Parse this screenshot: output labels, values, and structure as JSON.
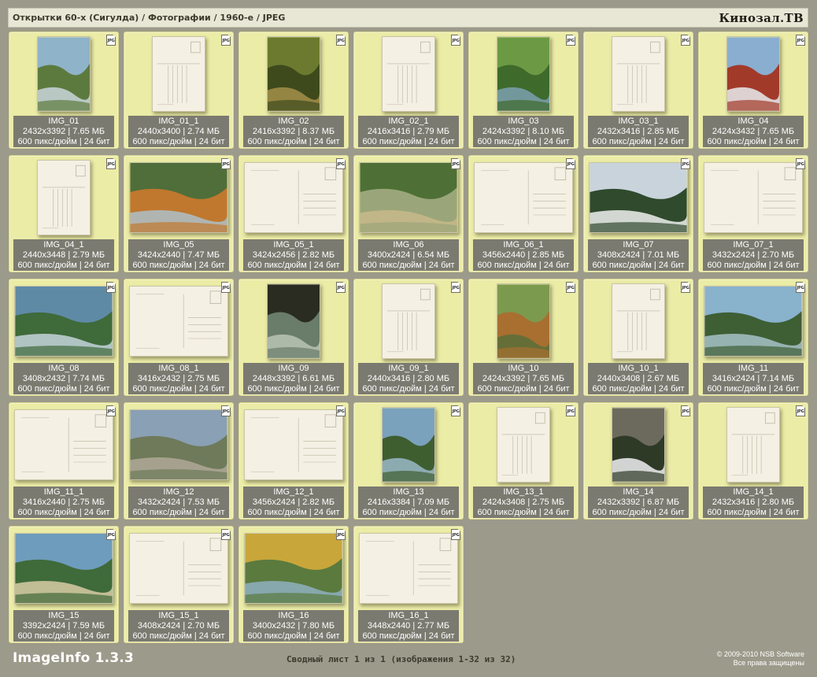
{
  "header": {
    "breadcrumb": "Открытки 60-х (Сигулда) / Фотографии / 1960-е / JPEG",
    "site": "Кинозал.ТВ"
  },
  "badge_label": "JPG",
  "tiles": [
    {
      "name": "IMG_01",
      "dims": "2432x3392 | 7.65 МБ",
      "meta": "600 пикс/дюйм | 24 бит",
      "orient": "portrait",
      "kind": "photo",
      "icon": "landscape-river-photo",
      "colors": [
        "#8fb3c8",
        "#5d7a3e",
        "#c9d6da"
      ]
    },
    {
      "name": "IMG_01_1",
      "dims": "2440x3400 | 2.74 МБ",
      "meta": "600 пикс/дюйм | 24 бит",
      "orient": "portrait",
      "kind": "back"
    },
    {
      "name": "IMG_02",
      "dims": "2416x3392 | 8.37 МБ",
      "meta": "600 пикс/дюйм | 24 бит",
      "orient": "portrait",
      "kind": "photo",
      "icon": "forest-cliff-photo",
      "colors": [
        "#6b7a2e",
        "#3e4a1c",
        "#a58f4a"
      ]
    },
    {
      "name": "IMG_02_1",
      "dims": "2416x3416 | 2.79 МБ",
      "meta": "600 пикс/дюйм | 24 бит",
      "orient": "portrait",
      "kind": "back"
    },
    {
      "name": "IMG_03",
      "dims": "2424x3392 | 8.10 МБ",
      "meta": "600 пикс/дюйм | 24 бит",
      "orient": "portrait",
      "kind": "photo",
      "icon": "river-valley-photo",
      "colors": [
        "#6c9a44",
        "#3e6a2c",
        "#7ca0b0"
      ]
    },
    {
      "name": "IMG_03_1",
      "dims": "2432x3416 | 2.85 МБ",
      "meta": "600 пикс/дюйм | 24 бит",
      "orient": "portrait",
      "kind": "back"
    },
    {
      "name": "IMG_04",
      "dims": "2424x3432 | 7.65 МБ",
      "meta": "600 пикс/дюйм | 24 бит",
      "orient": "portrait",
      "kind": "photo",
      "icon": "castle-tower-winter-photo",
      "colors": [
        "#8aaed0",
        "#a23a2a",
        "#e8ecee"
      ]
    },
    {
      "name": "IMG_04_1",
      "dims": "2440x3448 | 2.79 МБ",
      "meta": "600 пикс/дюйм | 24 бит",
      "orient": "portrait",
      "kind": "back"
    },
    {
      "name": "IMG_05",
      "dims": "3424x2440 | 7.47 МБ",
      "meta": "600 пикс/дюйм | 24 бит",
      "orient": "landscape",
      "kind": "photo",
      "icon": "autumn-valley-photo",
      "colors": [
        "#4f6e3a",
        "#c0782e",
        "#aebfc8"
      ]
    },
    {
      "name": "IMG_05_1",
      "dims": "3424x2456 | 2.82 МБ",
      "meta": "600 пикс/дюйм | 24 бит",
      "orient": "landscape",
      "kind": "back"
    },
    {
      "name": "IMG_06",
      "dims": "3400x2424 | 6.54 МБ",
      "meta": "600 пикс/дюйм | 24 бит",
      "orient": "landscape",
      "kind": "photo",
      "icon": "river-bend-photo",
      "colors": [
        "#4e7036",
        "#9aa67a",
        "#c8b98a"
      ]
    },
    {
      "name": "IMG_06_1",
      "dims": "3456x2440 | 2.85 МБ",
      "meta": "600 пикс/дюйм | 24 бит",
      "orient": "landscape",
      "kind": "back"
    },
    {
      "name": "IMG_07",
      "dims": "3408x2424 | 7.01 МБ",
      "meta": "600 пикс/дюйм | 24 бит",
      "orient": "landscape",
      "kind": "photo",
      "icon": "winter-spruce-photo",
      "colors": [
        "#c9d3dc",
        "#2f4a2c",
        "#eef0f0"
      ]
    },
    {
      "name": "IMG_07_1",
      "dims": "3432x2424 | 2.70 МБ",
      "meta": "600 пикс/дюйм | 24 бит",
      "orient": "landscape",
      "kind": "back"
    },
    {
      "name": "IMG_08",
      "dims": "3408x2432 | 7.74 МБ",
      "meta": "600 пикс/дюйм | 24 бит",
      "orient": "landscape",
      "kind": "photo",
      "icon": "river-rapids-photo",
      "colors": [
        "#5f8aa6",
        "#3f6a3a",
        "#c4d4dc"
      ]
    },
    {
      "name": "IMG_08_1",
      "dims": "3416x2432 | 2.75 МБ",
      "meta": "600 пикс/дюйм | 24 бит",
      "orient": "landscape",
      "kind": "back"
    },
    {
      "name": "IMG_09",
      "dims": "2448x3392 | 6.61 МБ",
      "meta": "600 пикс/дюйм | 24 бит",
      "orient": "portrait",
      "kind": "photo",
      "icon": "cave-arch-photo",
      "colors": [
        "#2a2c22",
        "#6a7c6a",
        "#b8c4b4"
      ]
    },
    {
      "name": "IMG_09_1",
      "dims": "2440x3416 | 2.80 МБ",
      "meta": "600 пикс/дюйм | 24 бит",
      "orient": "portrait",
      "kind": "back"
    },
    {
      "name": "IMG_10",
      "dims": "2424x3392 | 7.65 МБ",
      "meta": "600 пикс/дюйм | 24 бит",
      "orient": "portrait",
      "kind": "photo",
      "icon": "forest-hills-photo",
      "colors": [
        "#7c9a4e",
        "#a86f30",
        "#5a6e38"
      ]
    },
    {
      "name": "IMG_10_1",
      "dims": "2440x3408 | 2.67 МБ",
      "meta": "600 пикс/дюйм | 24 бит",
      "orient": "portrait",
      "kind": "back"
    },
    {
      "name": "IMG_11",
      "dims": "3416x2424 | 7.14 МБ",
      "meta": "600 пикс/дюйм | 24 бит",
      "orient": "landscape",
      "kind": "photo",
      "icon": "lake-forest-photo",
      "colors": [
        "#89b2cc",
        "#3e5e34",
        "#a6c2c8"
      ]
    },
    {
      "name": "IMG_11_1",
      "dims": "3416x2440 | 2.75 МБ",
      "meta": "600 пикс/дюйм | 24 бит",
      "orient": "landscape",
      "kind": "back"
    },
    {
      "name": "IMG_12",
      "dims": "3432x2424 | 7.53 МБ",
      "meta": "600 пикс/дюйм | 24 бит",
      "orient": "landscape",
      "kind": "photo",
      "icon": "building-fountain-photo",
      "colors": [
        "#8aa0b4",
        "#6e7a5a",
        "#b0a898"
      ]
    },
    {
      "name": "IMG_12_1",
      "dims": "3456x2424 | 2.82 МБ",
      "meta": "600 пикс/дюйм | 24 бит",
      "orient": "landscape",
      "kind": "back"
    },
    {
      "name": "IMG_13",
      "dims": "2416x3384 | 7.09 МБ",
      "meta": "600 пикс/дюйм | 24 бит",
      "orient": "portrait",
      "kind": "photo",
      "icon": "river-cliff-photo",
      "colors": [
        "#7aa2bc",
        "#3f5e30",
        "#9ab8c8"
      ]
    },
    {
      "name": "IMG_13_1",
      "dims": "2424x3408 | 2.75 МБ",
      "meta": "600 пикс/дюйм | 24 бит",
      "orient": "portrait",
      "kind": "back"
    },
    {
      "name": "IMG_14",
      "dims": "2432x3392 | 6.87 МБ",
      "meta": "600 пикс/дюйм | 24 бит",
      "orient": "portrait",
      "kind": "photo",
      "icon": "ruins-winter-photo",
      "colors": [
        "#6c6a5c",
        "#2e3a26",
        "#eef0f2"
      ]
    },
    {
      "name": "IMG_14_1",
      "dims": "2432x3416 | 2.80 МБ",
      "meta": "600 пикс/дюйм | 24 бит",
      "orient": "portrait",
      "kind": "back"
    },
    {
      "name": "IMG_15",
      "dims": "3392x2424 | 7.59 МБ",
      "meta": "600 пикс/дюйм | 24 бит",
      "orient": "landscape",
      "kind": "photo",
      "icon": "river-sandbank-photo",
      "colors": [
        "#6e9cbc",
        "#3f6a3a",
        "#d8cba4"
      ]
    },
    {
      "name": "IMG_15_1",
      "dims": "3408x2424 | 2.70 МБ",
      "meta": "600 пикс/дюйм | 24 бит",
      "orient": "landscape",
      "kind": "back"
    },
    {
      "name": "IMG_16",
      "dims": "3400x2432 | 7.80 МБ",
      "meta": "600 пикс/дюйм | 24 бит",
      "orient": "landscape",
      "kind": "photo",
      "icon": "autumn-lake-photo",
      "colors": [
        "#c8a63a",
        "#5a7a3e",
        "#8fb0c0"
      ]
    },
    {
      "name": "IMG_16_1",
      "dims": "3448x2440 | 2.77 МБ",
      "meta": "600 пикс/дюйм | 24 бит",
      "orient": "landscape",
      "kind": "back"
    }
  ],
  "footer": {
    "app": "ImageInfo 1.3.3",
    "summary": "Сводный лист 1 из 1 (изображения 1-32 из 32)",
    "copyright": "© 2009-2010 NSB Software",
    "rights": "Все права защищены"
  },
  "colors": {
    "background": "#9c9a8a",
    "tile": "#ebeca6",
    "info_panel": "#7b7a70",
    "header_bar": "#e8e7d6"
  }
}
